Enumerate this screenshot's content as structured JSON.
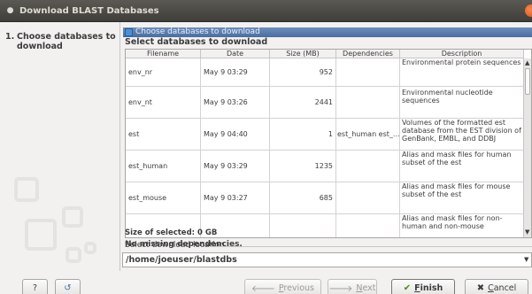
{
  "window": {
    "title": "Download BLAST Databases"
  },
  "steps": [
    {
      "number": "1.",
      "label": "Choose databases to download"
    }
  ],
  "page": {
    "header": "Choose databases to download",
    "subheader": "Select databases to download"
  },
  "table": {
    "columns": [
      "Filename",
      "Date",
      "Size (MB)",
      "Dependencies",
      "Description"
    ],
    "rows": [
      {
        "filename": "env_nr",
        "date": "May 9 03:29",
        "size": "952",
        "deps": "",
        "desc": "Environmental protein sequences"
      },
      {
        "filename": "env_nt",
        "date": "May 9 03:26",
        "size": "2441",
        "deps": "",
        "desc": "Environmental nucleotide sequences"
      },
      {
        "filename": "est",
        "date": "May 9 04:40",
        "size": "1",
        "deps": "est_human est_...",
        "desc": "Volumes of the formatted est database from the EST division of GenBank, EMBL, and DDBJ"
      },
      {
        "filename": "est_human",
        "date": "May 9 03:29",
        "size": "1235",
        "deps": "",
        "desc": "Alias and mask files for human subset of the est"
      },
      {
        "filename": "est_mouse",
        "date": "May 9 03:27",
        "size": "685",
        "deps": "",
        "desc": "Alias and mask files for mouse subset of the est"
      },
      {
        "filename": "",
        "date": "",
        "size": "",
        "deps": "",
        "desc": "Alias and mask files for non-human and non-mouse"
      }
    ]
  },
  "status": {
    "dependencies": "No missing dependencies.",
    "selected": "Size of selected: 0 GB"
  },
  "location": {
    "label": "Select download location",
    "value": "/home/joeuser/blastdbs"
  },
  "buttons": {
    "help": "?",
    "previous_u": "P",
    "previous_rest": "revious",
    "next_u": "N",
    "next_rest": "ext",
    "finish_u": "F",
    "finish_rest": "inish",
    "cancel_u": "C",
    "cancel_rest": "ancel"
  },
  "icons": {
    "help": "question-icon",
    "reset": "reset-icon",
    "previous": "arrow-left-icon",
    "next": "arrow-right-icon",
    "finish": "checkmark-icon",
    "cancel": "x-icon"
  }
}
